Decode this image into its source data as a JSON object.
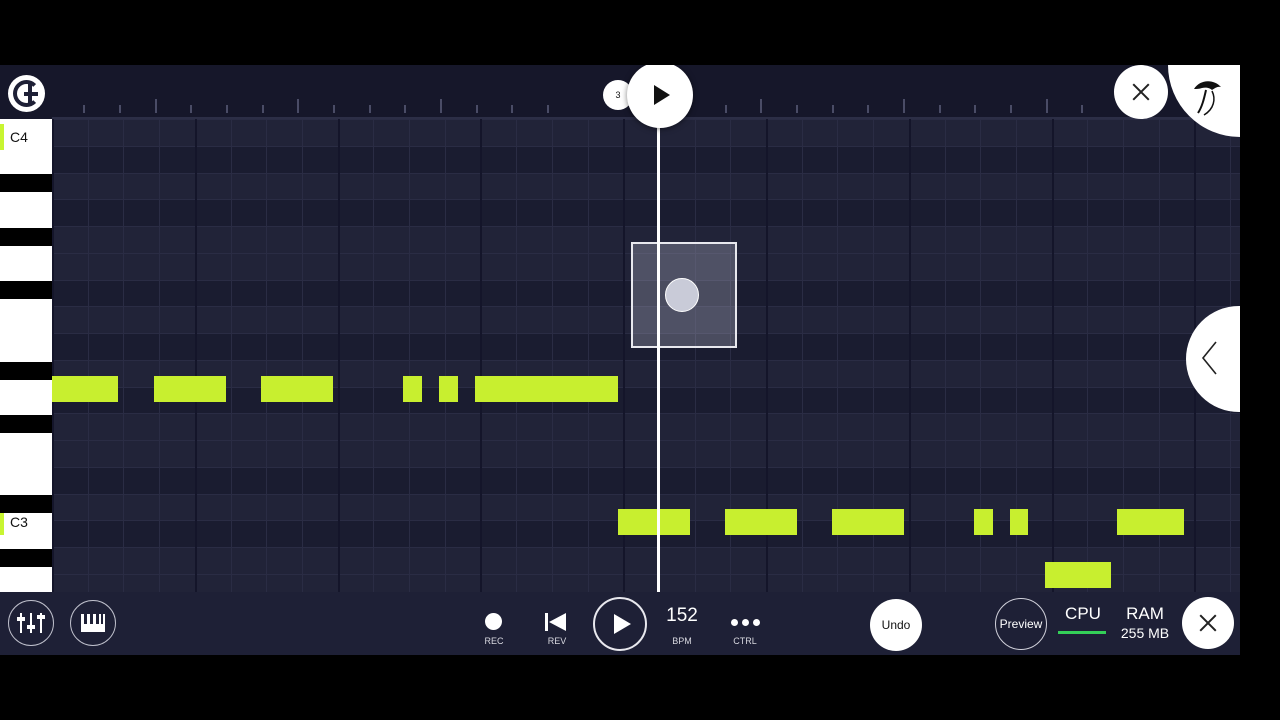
{
  "ruler": {
    "bar_number": "3"
  },
  "piano": {
    "label_top": "C4",
    "label_mid": "C3"
  },
  "controls": {
    "rec_label": "REC",
    "rev_label": "REV",
    "bpm_value": "152",
    "bpm_label": "BPM",
    "ctrl_label": "CTRL",
    "undo_label": "Undo",
    "preview_label": "Preview",
    "cpu_label": "CPU",
    "ram_label": "RAM",
    "ram_value": "255 MB"
  },
  "colors": {
    "note": "#c8ef2f",
    "background": "#1e2036",
    "cpu_meter": "#34d058"
  },
  "icons": {
    "logo": "fl-logo-icon",
    "close": "close-icon",
    "fruit": "fruit-logo-icon",
    "collapse": "chevron-left-icon",
    "mixer": "mixer-icon",
    "piano": "piano-icon",
    "rec": "record-icon",
    "rev": "rewind-icon",
    "play": "play-icon",
    "ctrl": "more-dots-icon"
  }
}
